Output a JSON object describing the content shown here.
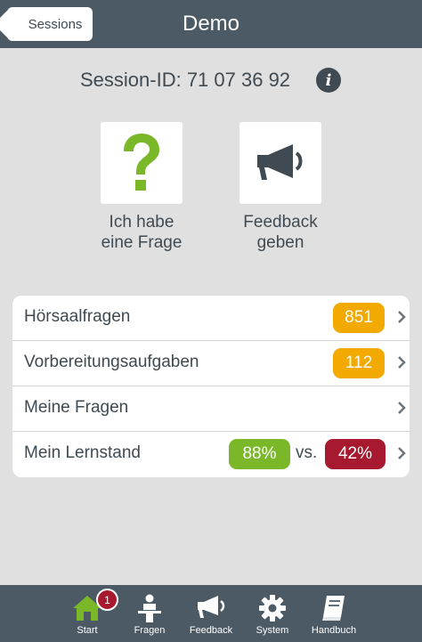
{
  "header": {
    "back_label": "Sessions",
    "title": "Demo"
  },
  "session": {
    "label": "Session-ID: 71 07 36 92"
  },
  "actions": {
    "question_line1": "Ich habe",
    "question_line2": "eine Frage",
    "feedback_line1": "Feedback",
    "feedback_line2": "geben"
  },
  "list": [
    {
      "label": "Hörsaalfragen",
      "badge": "851",
      "badge_color": "#f2a900"
    },
    {
      "label": "Vorbereitungsaufgaben",
      "badge": "112",
      "badge_color": "#f2a900"
    },
    {
      "label": "Meine Fragen"
    },
    {
      "label": "Mein Lernstand",
      "badge_left": "88%",
      "badge_left_color": "#7ab829",
      "vs": "vs.",
      "badge_right": "42%",
      "badge_right_color": "#a6192e"
    }
  ],
  "tabs": [
    {
      "label": "Start",
      "icon": "home-icon"
    },
    {
      "label": "Fragen",
      "icon": "lecturer-icon"
    },
    {
      "label": "Feedback",
      "icon": "megaphone-icon"
    },
    {
      "label": "System",
      "icon": "gear-icon"
    },
    {
      "label": "Handbuch",
      "icon": "book-icon"
    }
  ],
  "notification_count": "1",
  "colors": {
    "header_bg": "#4b5a64",
    "accent_green": "#7ab829",
    "badge_orange": "#f2a900",
    "badge_red": "#a6192e"
  }
}
